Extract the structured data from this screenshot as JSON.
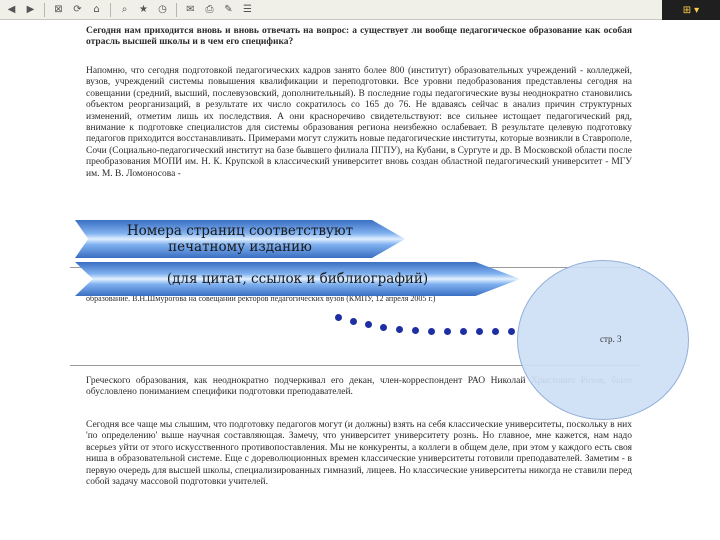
{
  "toolbar": {
    "icons": [
      "arrow-left-icon",
      "arrow-right-icon",
      "stop-icon",
      "refresh-icon",
      "home-icon",
      "search-icon",
      "favorites-icon",
      "history-icon",
      "mail-icon",
      "print-icon",
      "edit-icon",
      "discuss-icon",
      "windows-logo-icon"
    ]
  },
  "document": {
    "p1": "Сегодня нам приходится вновь и вновь отвечать на вопрос: а существует ли вообще педагогическое образование как особая отрасль высшей школы и в чем его специфика?",
    "p2": "Напомню, что сегодня подготовкой педагогических кадров занято более 800 (институт) образовательных учреждений - колледжей, вузов, учреждений системы повышения квалификации и переподготовки. Все уровни педобразования представлены сегодня на совещании (средний, высший, послевузовский, дополнительный). В последние годы педагогические вузы неоднократно становились объектом реорганизаций, в результате их число сократилось со 165 до 76. Не вдаваясь сейчас в анализ причин структурных изменений, отметим лишь их последствия. А они красноречиво свидетельствуют: все сильнее истощает педагогический ряд, внимание к подготовке специалистов для системы образования региона неизбежно ослабевает. В результате целевую подготовку педагогов приходится восстанавливать. Примерами могут служить новые педагогические институты, которые возникли в Ставрополе, Сочи (Социально-педагогический институт на базе бывшего филиала ПГПУ), на Кубани, в Сургуте и др. В Московской области после преобразования МОПИ им. Н. К. Крупской в классический университет вновь создан областной педагогический университет - МГУ им. М. В. Ломоносова -",
    "p3": "образование. В.Н.Шмурогова на совещании ректоров педагогических вузов (КМПУ, 12 апреля 2005 г.)",
    "p4": "Греческого образования, как неоднократно подчеркивал его декан, член-корреспондент РАО Николай Христович Розов, было обусловлено пониманием специфики подготовки преподавателей.",
    "p5": "Сегодня все чаще мы слышим, что подготовку педагогов могут (и должны) взять на себя классические университеты, поскольку в них 'по определению' выше научная составляющая. Замечу, что университет университету рознь. Но главное, мне кажется, нам надо всерьез уйти от этого искусственного противопоставления. Мы не конкуренты, а коллеги в общем деле, при этом у каждого есть своя ниша в образовательной системе. Еще с дореволюционных времен классические университеты готовили преподавателей. Заметим - в первую очередь для высшей школы, специализированных гимназий, лицеев. Но классические университеты никогда не ставили перед собой задачу массовой подготовки учителей.",
    "page_number": "стр. 3"
  },
  "banner1": {
    "line1": "Номера страниц соответствуют",
    "line2": "печатному изданию"
  },
  "banner2": {
    "text": "(для цитат, ссылок и библиографий)"
  },
  "colors": {
    "banner_dark": "#3a6fc2",
    "banner_light": "#e4f1ff",
    "dots": "#1d2fa3",
    "ellipse": "#cfe0f6"
  }
}
